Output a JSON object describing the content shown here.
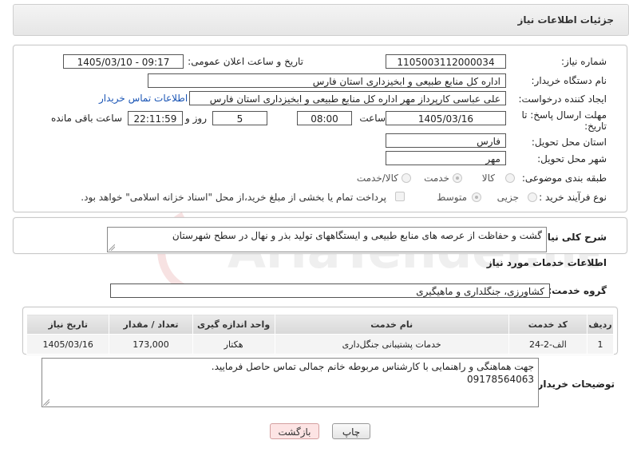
{
  "header": {
    "title": "جزئیات اطلاعات نیاز"
  },
  "form": {
    "need_number": {
      "label": "شماره نیاز:",
      "value": "1105003112000034"
    },
    "announce_datetime": {
      "label": "تاریخ و ساعت اعلان عمومی:",
      "value": "1405/03/10 - 09:17"
    },
    "buyer_org": {
      "label": "نام دستگاه خریدار:",
      "value": "اداره کل منابع طبیعی و ابخیزداری استان فارس"
    },
    "requester": {
      "label": "ایجاد کننده درخواست:",
      "value": "علی عباسی کارپرداز مهر اداره کل منابع طبیعی و ابخیزداری استان فارس",
      "contact_link": "اطلاعات تماس خریدار"
    },
    "deadline": {
      "label_line1": "مهلت ارسال پاسخ: تا",
      "label_line2": "تاریخ:",
      "date": "1405/03/16",
      "time_label": "ساعت",
      "time": "08:00",
      "days": "5",
      "days_label": "روز و",
      "remaining": "22:11:59",
      "remaining_label": "ساعت باقی مانده"
    },
    "delivery_province": {
      "label": "استان محل تحویل:",
      "value": "فارس"
    },
    "delivery_city": {
      "label": "شهر محل تحویل:",
      "value": "مهر"
    },
    "category": {
      "label": "طبقه بندی موضوعی:",
      "options": [
        "کالا",
        "خدمت",
        "کالا/خدمت"
      ],
      "selected": "خدمت"
    },
    "process": {
      "label": "نوع فرآیند خرید :",
      "options": [
        "جزیی",
        "متوسط"
      ],
      "selected": "متوسط",
      "payment_note": "پرداخت تمام یا بخشی از مبلغ خرید،از محل \"اسناد خزانه اسلامی\" خواهد بود."
    }
  },
  "summary": {
    "label": "شرح کلی نیاز:",
    "value": "گشت و حفاظت از عرصه های منابع طبیعی و ایستگاههای تولید بذر و نهال در سطح شهرستان"
  },
  "services": {
    "title": "اطلاعات خدمات مورد نیاز",
    "group_label": "گروه خدمت:",
    "group_value": "کشاورزی، جنگلداری و ماهیگیری",
    "columns": [
      "ردیف",
      "کد خدمت",
      "نام خدمت",
      "واحد اندازه گیری",
      "تعداد / مقدار",
      "تاریخ نیاز"
    ],
    "rows": [
      [
        "1",
        "الف-2-24",
        "خدمات پشتیبانی جنگل‌داری",
        "هکتار",
        "173,000",
        "1405/03/16"
      ]
    ]
  },
  "buyer_notes": {
    "label": "توضیحات خریدار:",
    "line1": "جهت هماهنگی و راهنمایی با کارشناس مربوطه خانم جمالی تماس حاصل فرمایید.",
    "line2": "09178564063"
  },
  "buttons": {
    "print": "چاپ",
    "back": "بازگشت"
  },
  "watermark": {
    "text": "AriaTender.net"
  }
}
